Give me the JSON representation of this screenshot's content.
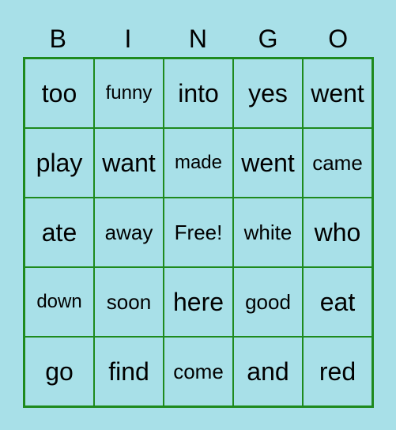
{
  "header": [
    "B",
    "I",
    "N",
    "G",
    "O"
  ],
  "cells": [
    [
      "too",
      "funny",
      "into",
      "yes",
      "went"
    ],
    [
      "play",
      "want",
      "made",
      "went",
      "came"
    ],
    [
      "ate",
      "away",
      "Free!",
      "white",
      "who"
    ],
    [
      "down",
      "soon",
      "here",
      "good",
      "eat"
    ],
    [
      "go",
      "find",
      "come",
      "and",
      "red"
    ]
  ],
  "colors": {
    "background": "#a8e0e8",
    "grid": "#1e8a1e"
  }
}
